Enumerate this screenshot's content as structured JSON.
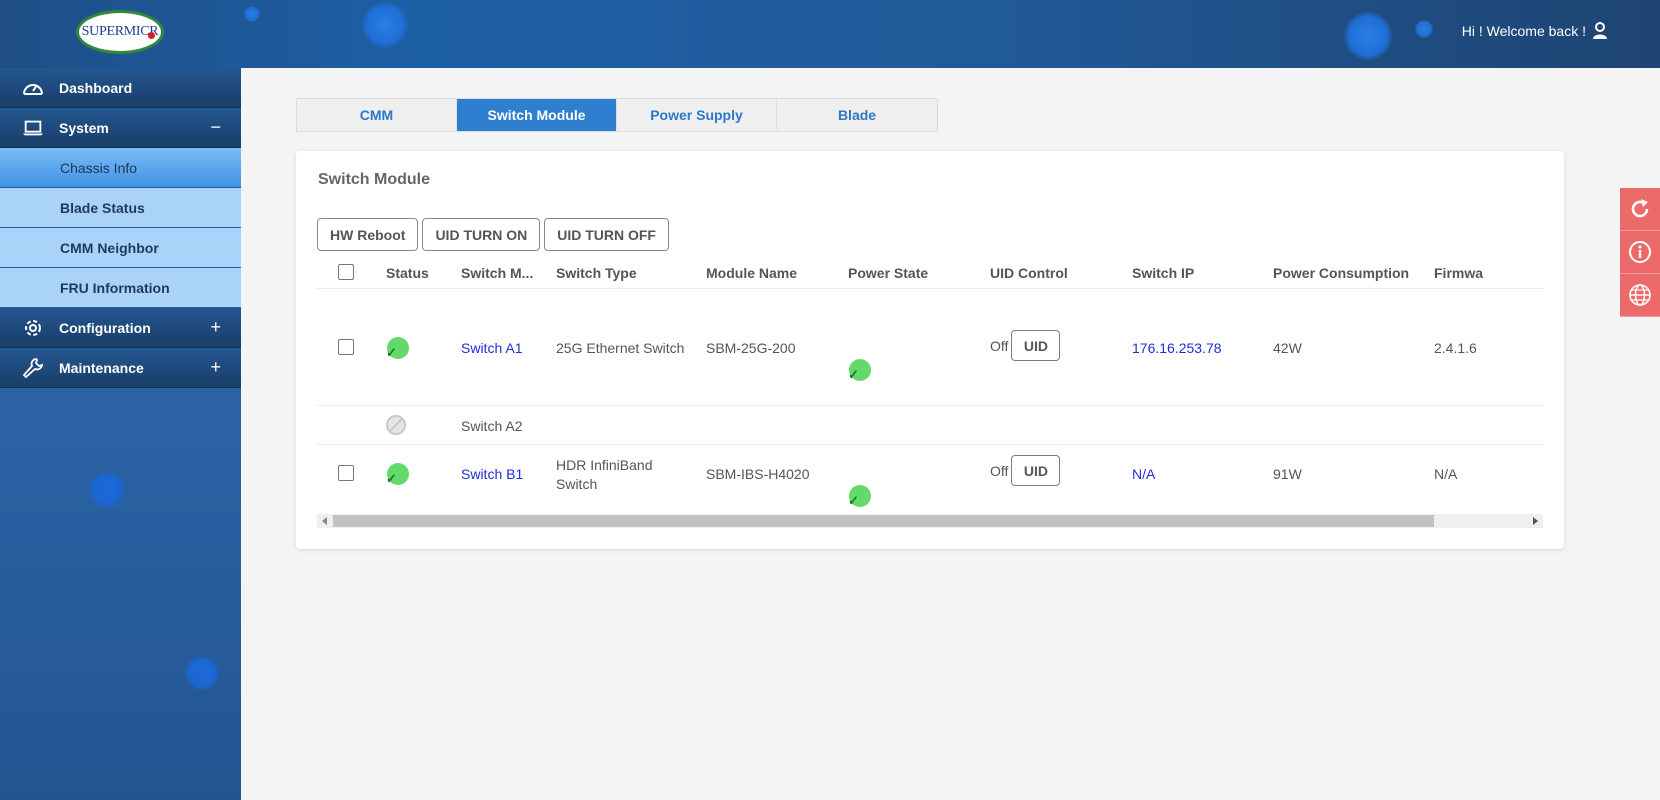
{
  "header": {
    "logo_text": "SUPERMICR",
    "welcome_text": "Hi ! Welcome back !"
  },
  "sidebar": {
    "items": [
      {
        "label": "Dashboard",
        "icon": "dashboard-gauge-icon",
        "toggle": ""
      },
      {
        "label": "System",
        "icon": "laptop-icon",
        "toggle": "−"
      },
      {
        "label": "Configuration",
        "icon": "gear-icon",
        "toggle": "+"
      },
      {
        "label": "Maintenance",
        "icon": "wrench-icon",
        "toggle": "+"
      }
    ],
    "sub_items": [
      {
        "label": "Chassis Info",
        "active": true
      },
      {
        "label": "Blade Status"
      },
      {
        "label": "CMM Neighbor"
      },
      {
        "label": "FRU Information"
      }
    ]
  },
  "tabs": [
    {
      "label": "CMM"
    },
    {
      "label": "Switch Module",
      "active": true
    },
    {
      "label": "Power Supply"
    },
    {
      "label": "Blade"
    }
  ],
  "card": {
    "title": "Switch Module",
    "buttons": [
      "HW Reboot",
      "UID TURN ON",
      "UID TURN OFF"
    ]
  },
  "table": {
    "headers": [
      "Status",
      "Switch M...",
      "Switch Type",
      "Module Name",
      "Power State",
      "UID Control",
      "Switch IP",
      "Power Consumption",
      "Firmwa"
    ],
    "rows": [
      {
        "status": "ok",
        "name": "Switch A1",
        "type": "25G Ethernet Switch",
        "type2": "",
        "module": "SBM-25G-200",
        "power_state": "ok",
        "uid_state": "Off",
        "uid_label": "UID",
        "ip": "176.16.253.78",
        "power": "42W",
        "firmware": "2.4.1.6"
      },
      {
        "status": "none",
        "name": "Switch A2"
      },
      {
        "status": "ok",
        "name": "Switch B1",
        "type": "HDR InfiniBand",
        "type2": "Switch",
        "module": "SBM-IBS-H4020",
        "power_state": "ok",
        "uid_state": "Off",
        "uid_label": "UID",
        "ip": "N/A",
        "power": "91W",
        "firmware": "N/A"
      }
    ]
  },
  "colors": {
    "accent": "#2f7fd1",
    "link": "#1e2fd8",
    "status_ok": "#63d96b",
    "tool_bg": "#ec6a6a"
  },
  "tools": [
    "refresh-icon",
    "info-icon",
    "globe-icon"
  ]
}
